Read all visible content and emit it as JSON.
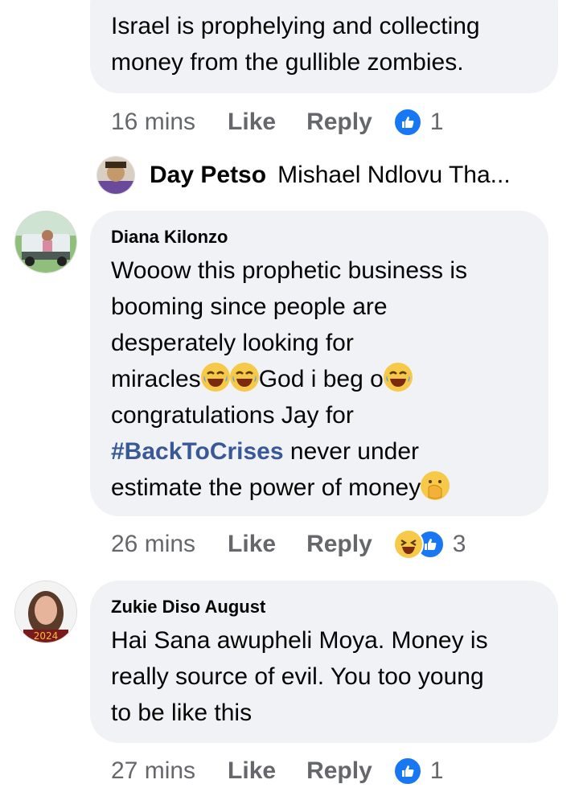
{
  "comments": [
    {
      "text": "Israel is prophelying and collecting money from the gullible zombies.",
      "time": "16 mins",
      "like_label": "Like",
      "reply_label": "Reply",
      "reaction_count": "1"
    },
    {
      "name": "Diana Kilonzo",
      "text_line1": "Wooow this prophetic  business is",
      "text_line2": "booming since people are",
      "text_line3": "desperately looking for",
      "text_line4a": "miracles",
      "text_line4b": "God i beg o",
      "text_line5": "congratulations Jay for",
      "hashtag": "#BackToCrises",
      "text_line6": " never  under",
      "text_line7": "estimate the power of money",
      "time": "26 mins",
      "like_label": "Like",
      "reply_label": "Reply",
      "reaction_count": "3"
    },
    {
      "name": "Zukie Diso August",
      "text_line1": "Hai Sana awupheli Moya.  Money is",
      "text_line2": "really source of evil. You too young",
      "text_line3": "to be like this",
      "time": "27 mins",
      "like_label": "Like",
      "reply_label": "Reply",
      "reaction_count": "1"
    }
  ],
  "reply_preview": {
    "name": "Day Petso",
    "text": "Mishael Ndlovu Tha..."
  },
  "colors": {
    "bubble": "#f0f2f5",
    "like_blue": "#1877f2",
    "meta_gray": "#65676b",
    "hashtag": "#385898"
  }
}
